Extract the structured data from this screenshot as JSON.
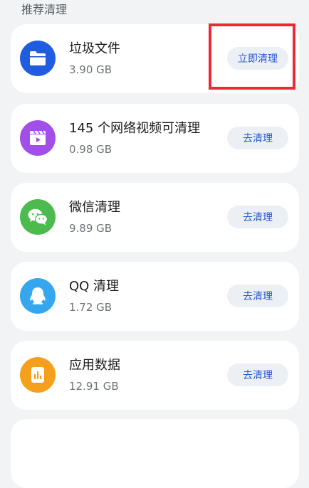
{
  "section": {
    "title": "推荐清理"
  },
  "items": [
    {
      "name": "垃圾文件",
      "size": "3.90 GB",
      "action": "立即清理",
      "icon": "folder-icon",
      "color": "#1f5ce0"
    },
    {
      "name": "145 个网络视频可清理",
      "size": "0.98 GB",
      "action": "去清理",
      "icon": "video-clapper-icon",
      "color": "#a24ee8"
    },
    {
      "name": "微信清理",
      "size": "9.89 GB",
      "action": "去清理",
      "icon": "wechat-icon",
      "color": "#4cba4f"
    },
    {
      "name": "QQ 清理",
      "size": "1.72 GB",
      "action": "去清理",
      "icon": "qq-penguin-icon",
      "color": "#35a7ee"
    },
    {
      "name": "应用数据",
      "size": "12.91 GB",
      "action": "去清理",
      "icon": "app-data-icon",
      "color": "#f5a01d"
    }
  ],
  "highlight_color": "#ea2b37"
}
